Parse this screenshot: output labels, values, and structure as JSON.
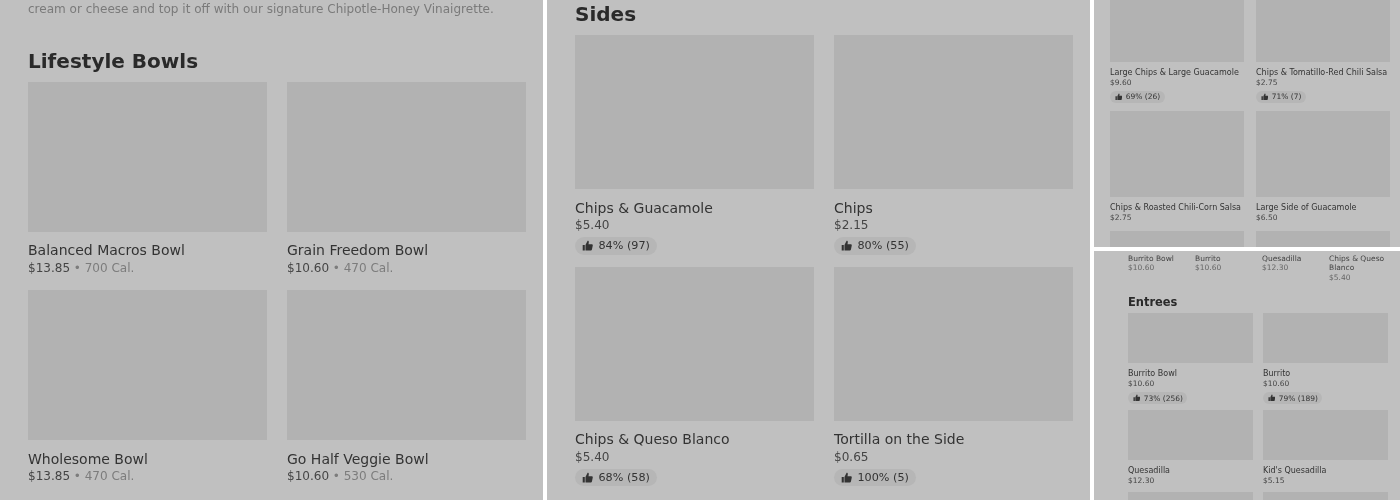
{
  "panels": [
    {
      "description": "cream or cheese and top it off with our signature Chipotle-Honey Vinaigrette.",
      "sections": [
        {
          "title": "Lifestyle Bowls",
          "items": [
            {
              "kind": "dish",
              "name": "Balanced Macros Bowl",
              "price": "$13.85",
              "calories": "• 700 Cal."
            },
            {
              "kind": "dish",
              "name": "Grain Freedom Bowl",
              "price": "$10.60",
              "calories": "• 470 Cal."
            },
            {
              "kind": "dish",
              "name": "Wholesome Bowl",
              "price": "$13.85",
              "calories": "• 470 Cal."
            },
            {
              "kind": "dish",
              "name": "Go Half Veggie Bowl",
              "price": "$10.60",
              "calories": "• 530 Cal."
            }
          ]
        }
      ]
    },
    {
      "sections": [
        {
          "title": "Sides",
          "items": [
            {
              "kind": "dish",
              "name": "Chips & Guacamole",
              "price": "$5.40",
              "rating": "84% (97)"
            },
            {
              "kind": "dish",
              "name": "Chips",
              "price": "$2.15",
              "rating": "80% (55)"
            },
            {
              "kind": "dish",
              "name": "Chips & Queso Blanco",
              "price": "$5.40",
              "rating": "68% (58)"
            },
            {
              "kind": "dish",
              "name": "Tortilla on the Side",
              "price": "$0.65",
              "rating": "100% (5)"
            }
          ]
        }
      ]
    },
    {
      "sections": [
        {
          "items": [
            {
              "kind": "dish",
              "name": "Large Chips & Large Guacamole",
              "price": "$9.60",
              "rating": "69% (26)"
            },
            {
              "kind": "dish",
              "name": "Chips & Tomatillo-Red Chili Salsa",
              "price": "$2.75",
              "rating": "71% (7)"
            },
            {
              "kind": "dish",
              "name": "Chips & Roasted Chili-Corn Salsa",
              "price": "$2.75"
            },
            {
              "kind": "dish",
              "name": "Large Side of Guacamole",
              "price": "$6.50"
            },
            {
              "kind": "image-only"
            },
            {
              "kind": "image-only"
            }
          ]
        }
      ]
    },
    {
      "top_items": [
        {
          "name": "Burrito Bowl",
          "price": "$10.60"
        },
        {
          "name": "Burrito",
          "price": "$10.60"
        },
        {
          "name": "Quesadilla",
          "price": "$12.30"
        },
        {
          "name": "Chips & Queso Blanco",
          "price": "$5.40"
        }
      ],
      "sections": [
        {
          "title": "Entrees",
          "items": [
            {
              "kind": "dish",
              "name": "Burrito Bowl",
              "price": "$10.60",
              "rating": "73% (256)"
            },
            {
              "kind": "dish",
              "name": "Burrito",
              "price": "$10.60",
              "rating": "79% (189)"
            },
            {
              "kind": "dish",
              "name": "Quesadilla",
              "price": "$12.30"
            },
            {
              "kind": "dish",
              "name": "Kid's Quesadilla",
              "price": "$5.15"
            },
            {
              "kind": "image-only"
            },
            {
              "kind": "image-only"
            }
          ]
        }
      ]
    }
  ]
}
